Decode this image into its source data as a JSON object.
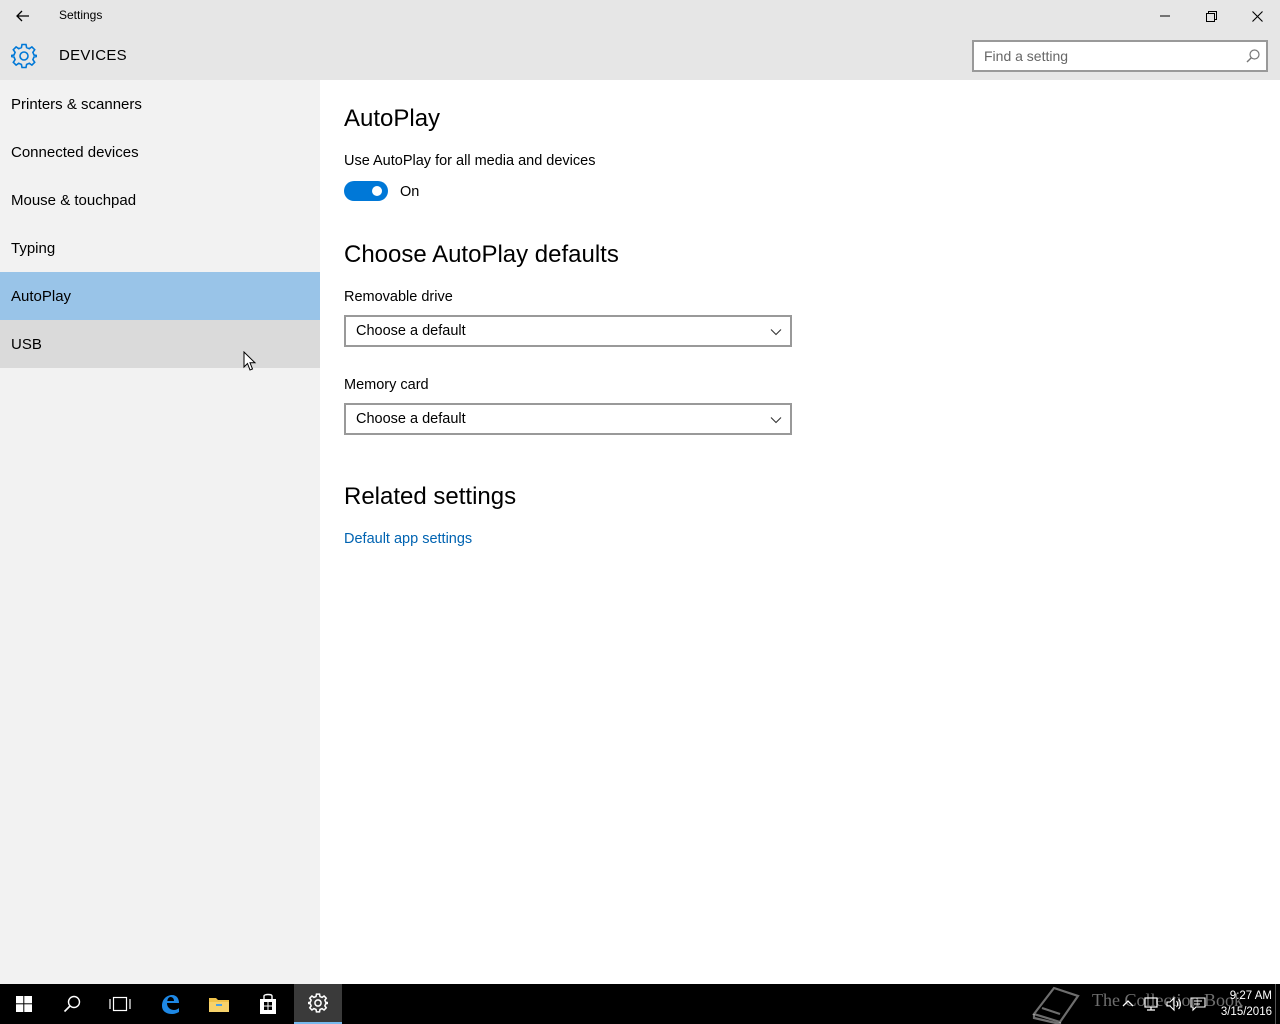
{
  "window": {
    "title": "Settings",
    "back_label": "Back",
    "minimize_label": "Minimize",
    "maximize_label": "Restore",
    "close_label": "Close"
  },
  "header": {
    "section_title": "DEVICES",
    "icon": "gear-icon",
    "search_placeholder": "Find a setting",
    "search_value": ""
  },
  "sidebar": {
    "items": [
      {
        "label": "Printers & scanners",
        "selected": false
      },
      {
        "label": "Connected devices",
        "selected": false
      },
      {
        "label": "Mouse & touchpad",
        "selected": false
      },
      {
        "label": "Typing",
        "selected": false
      },
      {
        "label": "AutoPlay",
        "selected": true
      },
      {
        "label": "USB",
        "selected": false,
        "hovered": true
      }
    ]
  },
  "main": {
    "title": "AutoPlay",
    "autoplay_toggle": {
      "label": "Use AutoPlay for all media and devices",
      "state_text": "On",
      "on": true
    },
    "defaults_heading": "Choose AutoPlay defaults",
    "removable_drive": {
      "label": "Removable drive",
      "value": "Choose a default"
    },
    "memory_card": {
      "label": "Memory card",
      "value": "Choose a default"
    },
    "related_heading": "Related settings",
    "related_link": "Default app settings"
  },
  "taskbar": {
    "items": [
      "start-icon",
      "search-icon",
      "task-view-icon",
      "edge-icon",
      "file-explorer-icon",
      "store-icon",
      "settings-icon"
    ],
    "active": "settings-icon",
    "watermark_text": "The Collection Book",
    "time": "9:27 AM",
    "date": "3/15/2016"
  },
  "colors": {
    "accent": "#0078d7",
    "selected_nav": "#99c4e8",
    "link": "#0063b1",
    "chrome": "#e6e6e6",
    "sidebar": "#f2f2f2"
  }
}
